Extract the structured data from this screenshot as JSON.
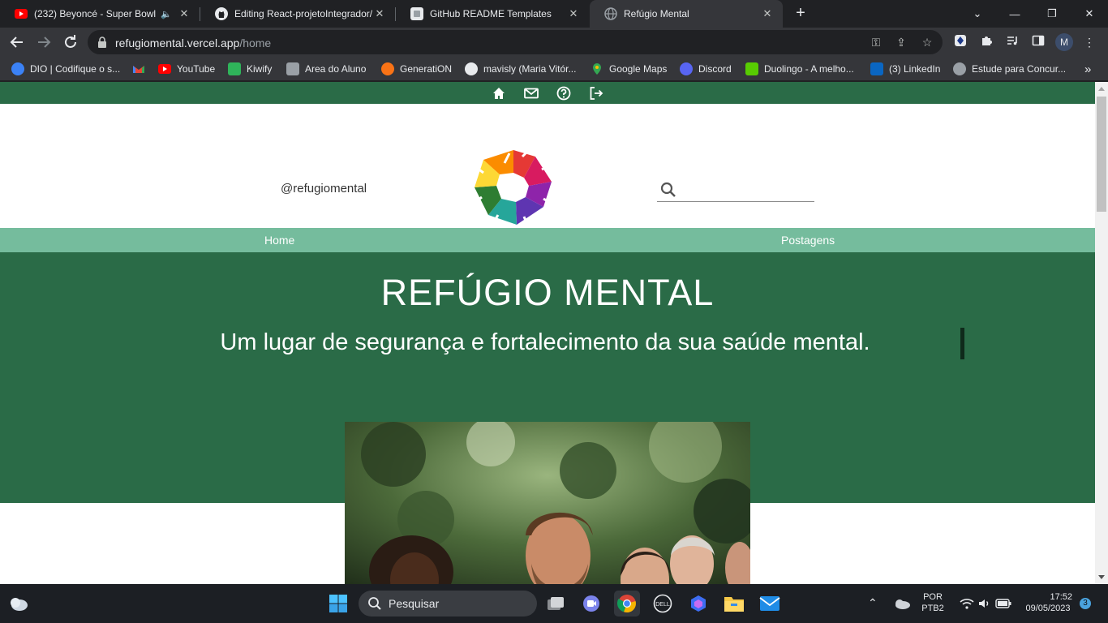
{
  "browser": {
    "tabs": [
      {
        "title": "(232) Beyoncé - Super Bowl X",
        "favicon": "youtube-icon",
        "muted_icon": "speaker-icon"
      },
      {
        "title": "Editing React-projetoIntegrador/",
        "favicon": "github-icon"
      },
      {
        "title": "GitHub README Templates",
        "favicon": "readme-templates-icon"
      },
      {
        "title": "Refúgio Mental",
        "favicon": "globe-icon",
        "active": true
      }
    ],
    "address": {
      "host": "refugiomental.vercel.app",
      "path": "/home"
    },
    "profile_initial": "M",
    "bookmarks": [
      {
        "label": "DIO | Codifique o s...",
        "icon": "dio-icon",
        "color": "#3b82f6"
      },
      {
        "label": "",
        "icon": "gmail-icon",
        "color": "#ea4335"
      },
      {
        "label": "YouTube",
        "icon": "youtube-icon",
        "color": "#ff0000"
      },
      {
        "label": "Kiwify",
        "icon": "kiwify-icon",
        "color": "#2fb45a"
      },
      {
        "label": "Area do Aluno",
        "icon": "area-aluno-icon",
        "color": "#9aa0a6"
      },
      {
        "label": "GeneratiON",
        "icon": "generation-icon",
        "color": "#f97316"
      },
      {
        "label": "mavisly (Maria Vitór...",
        "icon": "github-icon",
        "color": "#e8eaed"
      },
      {
        "label": "Google Maps",
        "icon": "maps-icon",
        "color": "#34a853"
      },
      {
        "label": "Discord",
        "icon": "discord-icon",
        "color": "#5865f2"
      },
      {
        "label": "Duolingo - A melho...",
        "icon": "duolingo-icon",
        "color": "#58cc02"
      },
      {
        "label": "(3) LinkedIn",
        "icon": "linkedin-icon",
        "color": "#0a66c2"
      },
      {
        "label": "Estude para Concur...",
        "icon": "concurso-icon",
        "color": "#9aa0a6"
      }
    ],
    "bookmarks_overflow": "»"
  },
  "page": {
    "handle": "@refugiomental",
    "search_placeholder": "",
    "menu": [
      "Home",
      "Postagens"
    ],
    "hero_title": "REFÚGIO MENTAL",
    "hero_subtitle": "Um lugar de segurança e fortalecimento da sua saúde mental.",
    "colors": {
      "primary": "#2a6b47",
      "menu": "#75bc9d"
    },
    "top_icons": [
      "home-icon",
      "mail-icon",
      "help-icon",
      "logout-icon"
    ]
  },
  "taskbar": {
    "search_label": "Pesquisar",
    "language": "POR",
    "layout": "PTB2",
    "time": "17:52",
    "date": "09/05/2023",
    "notifications": "3"
  }
}
